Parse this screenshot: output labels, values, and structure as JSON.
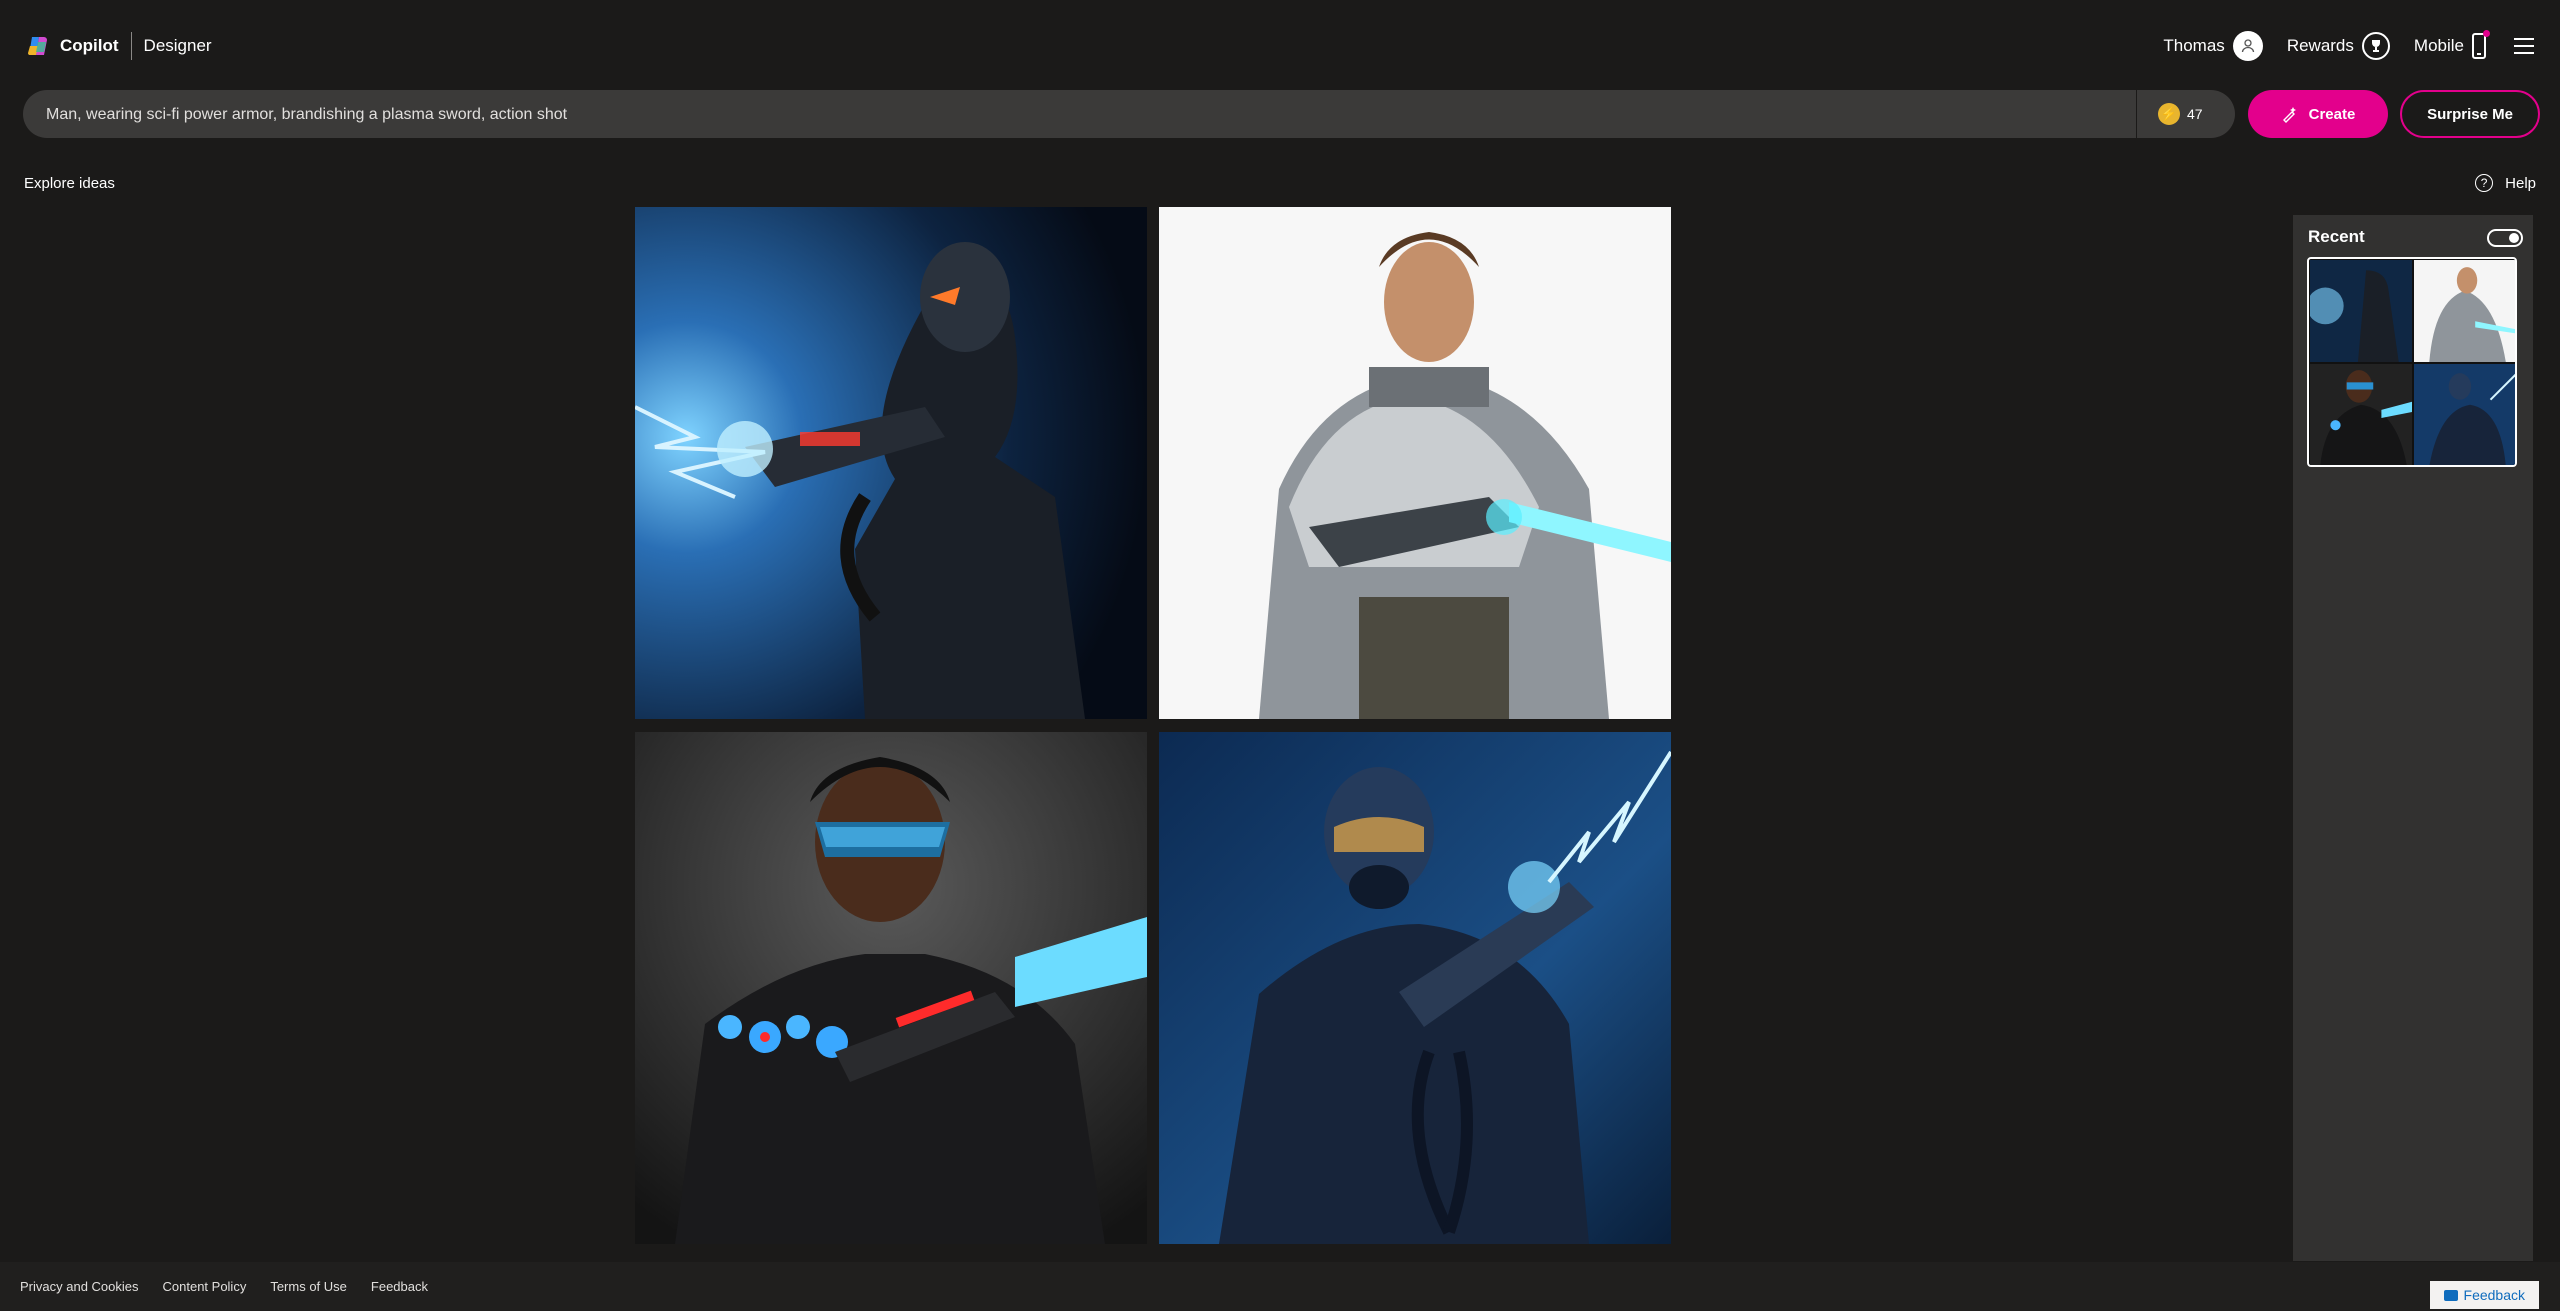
{
  "header": {
    "brand_name": "Copilot",
    "product_name": "Designer",
    "user_name": "Thomas",
    "rewards_label": "Rewards",
    "mobile_label": "Mobile"
  },
  "prompt": {
    "value": "Man, wearing sci-fi power armor, brandishing a plasma sword, action shot",
    "boost_count": "47",
    "create_label": "Create",
    "surprise_label": "Surprise Me"
  },
  "explore_label": "Explore ideas",
  "help_label": "Help",
  "results": [
    {
      "description": "Armored figure in dark helmet firing blue lightning gun"
    },
    {
      "description": "Bearded man in grey power armor holding cyan plasma blade"
    },
    {
      "description": "Man in goggles and black armor holding glowing blue weapon"
    },
    {
      "description": "Helmeted soldier in blue armor firing electric plasma rifle"
    }
  ],
  "recent": {
    "title": "Recent",
    "toggle_on": true
  },
  "footer": {
    "links": [
      "Privacy and Cookies",
      "Content Policy",
      "Terms of Use",
      "Feedback"
    ],
    "feedback_button": "Feedback"
  },
  "colors": {
    "background": "#1b1a19",
    "accent": "#e3008c",
    "prompt_bg": "#3b3a39",
    "panel_bg": "#323130",
    "boost": "#e8b52e"
  }
}
